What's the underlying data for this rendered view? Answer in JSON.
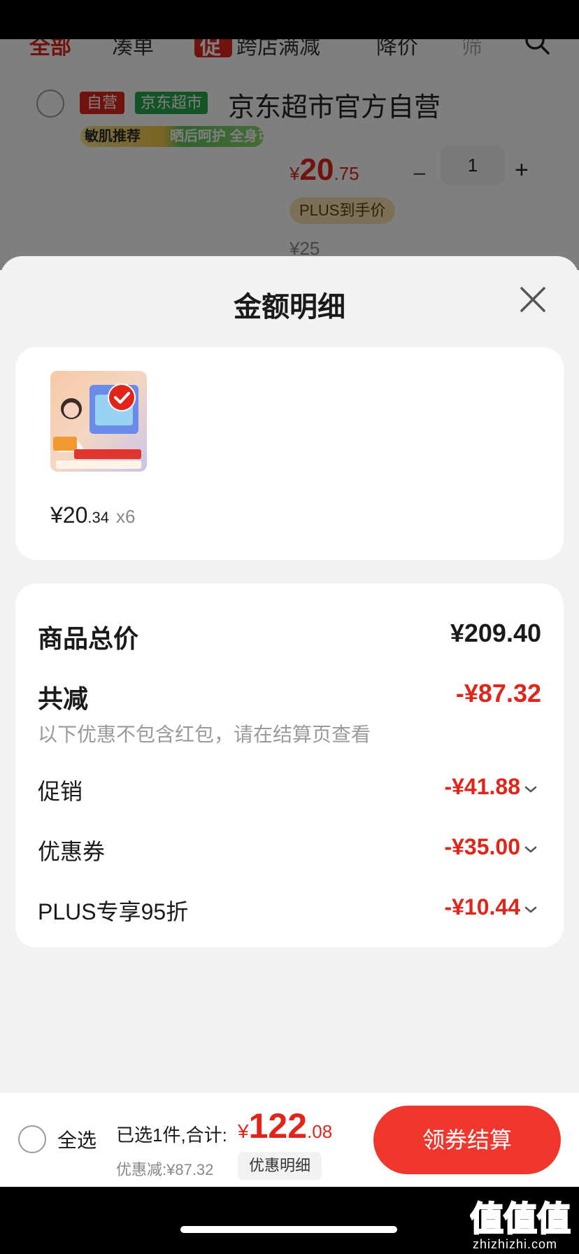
{
  "cart": {
    "tabs": [
      {
        "label": "全部",
        "active": true
      },
      {
        "label": "凑单",
        "active": false
      },
      {
        "label": "促",
        "active": false
      },
      {
        "label": "跨店满减",
        "active": false
      },
      {
        "label": "降价",
        "active": false
      },
      {
        "label": "筛",
        "active": false
      }
    ],
    "shop": {
      "tag_self": "自营",
      "tag_market": "京东超市",
      "name": "京东超市官方自营"
    },
    "promo_pill": {
      "left": "敏肌推荐",
      "right": "晒后呵护 全身可用"
    },
    "item": {
      "price_currency": "¥",
      "price_int": "20",
      "price_dec": ".75",
      "quantity": "1",
      "plus_tag": "PLUS到手价",
      "original_price": "¥25"
    }
  },
  "sheet": {
    "title": "金额明细",
    "goods": {
      "unit_price_int": "¥20",
      "unit_price_dec": ".34",
      "quantity_text": "x6"
    },
    "breakdown": {
      "subtotal_label": "商品总价",
      "subtotal_value": "¥209.40",
      "total_reduce_label": "共减",
      "total_reduce_value": "-¥87.32",
      "note": "以下优惠不包含红包，请在结算页查看",
      "lines": [
        {
          "label": "促销",
          "value": "-¥41.88"
        },
        {
          "label": "优惠券",
          "value": "-¥35.00"
        },
        {
          "label": "PLUS专享95折",
          "value": "-¥10.44"
        }
      ]
    }
  },
  "checkout": {
    "select_all": "全选",
    "selected_text": "已选1件,合计:",
    "total_currency": "¥",
    "total_int": "122",
    "total_dec": ".08",
    "discount_text": "优惠减:¥87.32",
    "detail_chip": "优惠明细",
    "button": "领券结算"
  },
  "watermark": {
    "glyphs": "值值值",
    "text": "zhizhizhi.com"
  },
  "colors": {
    "accent_red": "#e1251b",
    "button_red": "#f0372d",
    "market_green": "#27a74a",
    "plus_gold": "#f6e3b0"
  },
  "icons": [
    "search-icon",
    "download-icon",
    "share-icon",
    "close-icon",
    "check-icon",
    "chevron-down-icon"
  ]
}
